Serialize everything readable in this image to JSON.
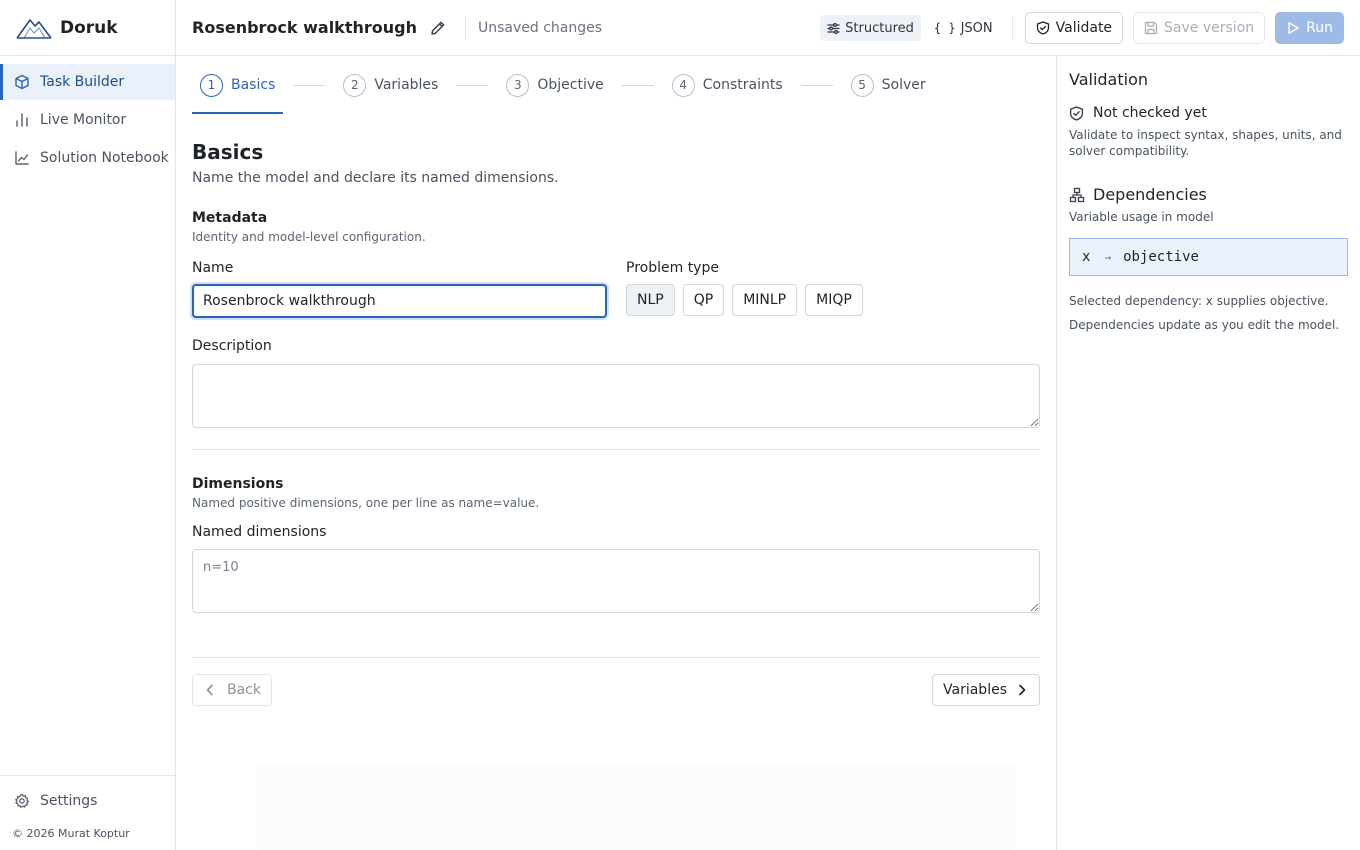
{
  "app": {
    "name": "Doruk"
  },
  "sidebar": {
    "items": [
      {
        "label": "Task Builder",
        "icon": "cube-icon",
        "active": true
      },
      {
        "label": "Live Monitor",
        "icon": "bar-chart-icon",
        "active": false
      },
      {
        "label": "Solution Notebook",
        "icon": "line-chart-icon",
        "active": false
      }
    ],
    "settings_label": "Settings",
    "copyright": "© 2026 Murat Koptur"
  },
  "topbar": {
    "title": "Rosenbrock walkthrough",
    "status": "Unsaved changes",
    "structured_label": "Structured",
    "json_label": "JSON",
    "validate_label": "Validate",
    "save_label": "Save version",
    "run_label": "Run"
  },
  "stepper": {
    "steps": [
      {
        "num": "1",
        "label": "Basics"
      },
      {
        "num": "2",
        "label": "Variables"
      },
      {
        "num": "3",
        "label": "Objective"
      },
      {
        "num": "4",
        "label": "Constraints"
      },
      {
        "num": "5",
        "label": "Solver"
      }
    ]
  },
  "basics": {
    "title": "Basics",
    "subtitle": "Name the model and declare its named dimensions.",
    "metadata_title": "Metadata",
    "metadata_sub": "Identity and model-level configuration.",
    "name_label": "Name",
    "name_value": "Rosenbrock walkthrough",
    "problem_type_label": "Problem type",
    "problem_types": [
      "NLP",
      "QP",
      "MINLP",
      "MIQP"
    ],
    "selected_problem_type": "NLP",
    "description_label": "Description",
    "description_value": "",
    "dimensions_title": "Dimensions",
    "dimensions_sub": "Named positive dimensions, one per line as name=value.",
    "named_dimensions_label": "Named dimensions",
    "named_dimensions_placeholder": "n=10",
    "back_label": "Back",
    "next_label": "Variables"
  },
  "validation": {
    "title": "Validation",
    "status": "Not checked yet",
    "description": "Validate to inspect syntax, shapes, units, and solver compatibility.",
    "dependencies_title": "Dependencies",
    "dependencies_sub": "Variable usage in model",
    "dependency": {
      "from": "x",
      "arrow": "→",
      "to": "objective"
    },
    "selected_note": "Selected dependency: x supplies objective.",
    "update_note": "Dependencies update as you edit the model."
  },
  "colors": {
    "accent": "#2a64b8",
    "accent_light": "#eaf1fb",
    "run_disabled": "#9dbbe6"
  }
}
